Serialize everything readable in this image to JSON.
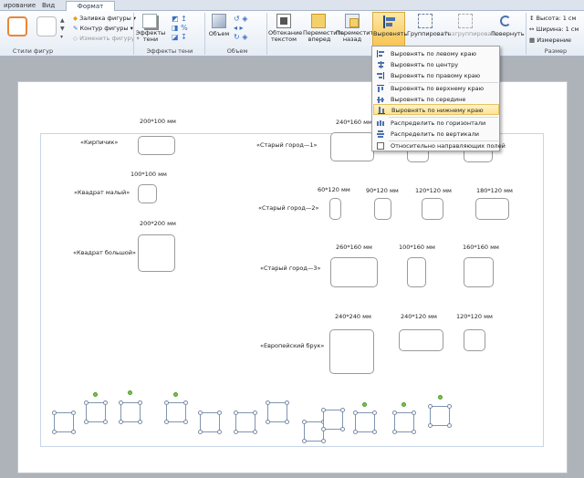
{
  "tabs": {
    "t1": "ирование",
    "t2": "Вид",
    "t3": "Формат"
  },
  "ribbon": {
    "shape_styles_label": "Стили фигур",
    "fill": "Заливка фигуры",
    "outline": "Контур фигуры",
    "change": "Изменить фигуру",
    "shadow_effects": "Эффекты тени",
    "shadow_effects_group": "Эффекты тени",
    "volume": "Объем",
    "volume_group": "Объем",
    "wrap": "Обтекание текстом",
    "forward": "Переместить вперед",
    "backward": "Переместить назад",
    "align": "Выровнять",
    "group": "Группировать",
    "ungroup": "Разгруппировать",
    "rotate": "Повернуть",
    "height_label": "Высота:",
    "height_val": "1 см",
    "width_label": "Ширина:",
    "width_val": "1 см",
    "measure": "Измерение",
    "size_group": "Размер"
  },
  "menu": {
    "items": [
      "Выровнять по левому краю",
      "Выровнять по центру",
      "Выровнять по правому краю",
      "Выровнять по верхнему краю",
      "Выровнять по середине",
      "Выровнять по нижнему краю",
      "Распределить по горизонтали",
      "Распределить по вертикали",
      "Относительно направляющих полей"
    ]
  },
  "doc": {
    "kirpichik": "«Кирпичик»",
    "kirpichik_dim": "200*100 мм",
    "kv_maly": "«Квадрат малый»",
    "kv_maly_dim": "100*100 мм",
    "kv_bolshoy": "«Квадрат большой»",
    "kv_bolshoy_dim": "200*200 мм",
    "sg1": "«Старый город—1»",
    "sg1_dim": "240*160 мм",
    "sg2": "«Старый город—2»",
    "sg2_d1": "60*120 мм",
    "sg2_d2": "90*120 мм",
    "sg2_d3": "120*120 мм",
    "sg2_d4": "180*120 мм",
    "sg3": "«Старый город—3»",
    "sg3_d1": "260*160 мм",
    "sg3_d2": "100*160 мм",
    "sg3_d3": "160*160 мм",
    "evro": "«Европейский брук»",
    "evro_d1": "240*240 мм",
    "evro_d2": "240*120 мм",
    "evro_d3": "120*120 мм"
  }
}
